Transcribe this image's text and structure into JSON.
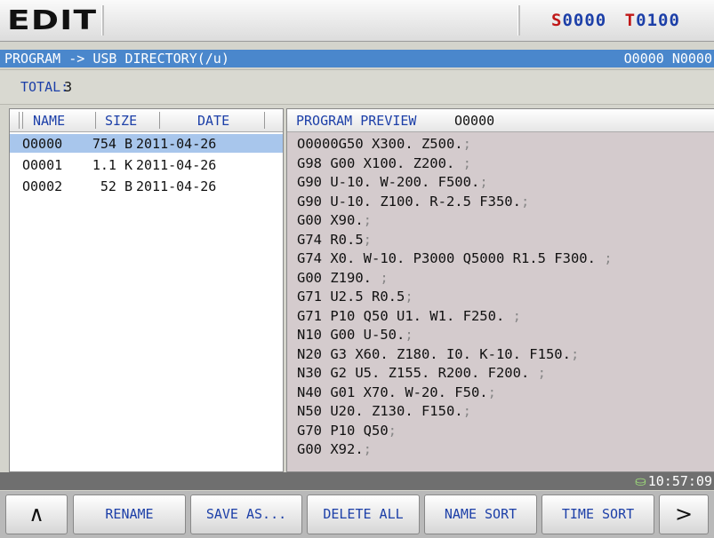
{
  "header": {
    "mode": "EDIT",
    "spindle_prefix": "S",
    "spindle_value": "0000",
    "tool_prefix": "T",
    "tool_value": "0100"
  },
  "path_bar": {
    "path": "PROGRAM -> USB DIRECTORY(/u)",
    "program_number": "O0000 N0000"
  },
  "total": {
    "label": "TOTAL:",
    "value": "3"
  },
  "file_list": {
    "columns": [
      "NAME",
      "SIZE",
      "DATE"
    ],
    "rows": [
      {
        "name": "O0000",
        "size": "754 B",
        "date": "2011-04-26",
        "selected": true
      },
      {
        "name": "O0001",
        "size": "1.1 K",
        "date": "2011-04-26",
        "selected": false
      },
      {
        "name": "O0002",
        "size": "52 B",
        "date": "2011-04-26",
        "selected": false
      }
    ]
  },
  "preview": {
    "title": "PROGRAM PREVIEW",
    "program": "O0000",
    "lines": [
      {
        "text": "O0000G50 X300. Z500.",
        "end": ";"
      },
      {
        "text": "G98 G00 X100. Z200. ",
        "end": ";"
      },
      {
        "text": "G90 U-10. W-200. F500.",
        "end": ";"
      },
      {
        "text": "G90 U-10. Z100. R-2.5 F350.",
        "end": ";"
      },
      {
        "text": "G00 X90.",
        "end": ";"
      },
      {
        "text": "G74 R0.5",
        "end": ";"
      },
      {
        "text": "G74 X0. W-10. P3000 Q5000 R1.5 F300. ",
        "end": ";"
      },
      {
        "text": "G00 Z190. ",
        "end": ";"
      },
      {
        "text": "G71 U2.5 R0.5",
        "end": ";"
      },
      {
        "text": "G71 P10 Q50 U1. W1. F250. ",
        "end": ";"
      },
      {
        "text": "N10 G00 U-50.",
        "end": ";"
      },
      {
        "text": "N20 G3 X60. Z180. I0. K-10. F150.",
        "end": ";"
      },
      {
        "text": "N30 G2 U5. Z155. R200. F200. ",
        "end": ";"
      },
      {
        "text": "N40 G01 X70. W-20. F50.",
        "end": ";"
      },
      {
        "text": "N50 U20. Z130. F150.",
        "end": ";"
      },
      {
        "text": "G70 P10 Q50",
        "end": ";"
      },
      {
        "text": "G00 X92.",
        "end": ";"
      }
    ]
  },
  "status": {
    "usb_icon": "usb-icon",
    "usb_glyph": "⛀",
    "time": "10:57:09"
  },
  "softkeys": {
    "prev": "∧",
    "rename": "RENAME",
    "save_as": "SAVE AS...",
    "delete_all": "DELETE ALL",
    "name_sort": "NAME SORT",
    "time_sort": "TIME SORT",
    "next": ">"
  },
  "colors": {
    "path_bar": "#4a87cc",
    "accent_blue": "#1c3fa8",
    "accent_red": "#c01818",
    "selection": "#a8c6ec",
    "preview_bg": "#d4cbcd"
  }
}
